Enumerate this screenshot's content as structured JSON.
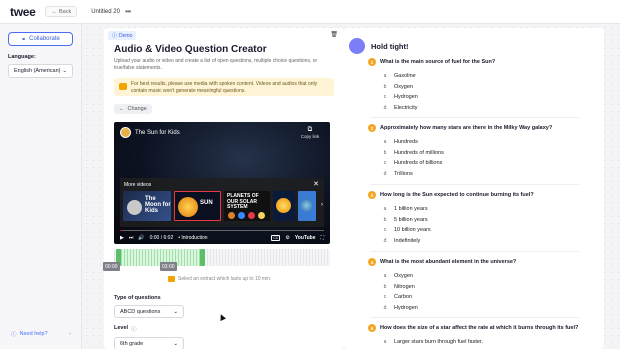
{
  "app": {
    "logo": "twee",
    "back_label": "Back",
    "doc_title": "Untitled 20",
    "menu_icon": "ellipsis-icon"
  },
  "sidebar": {
    "collaborate_label": "Collaborate",
    "language_label": "Language:",
    "language_value": "English (American)",
    "help_label": "Need help?"
  },
  "creator": {
    "badge": "Demo",
    "title": "Audio & Video Question Creator",
    "description": "Upload your audio or video and create a list of open questions, multiple choice questions, or true/false statements.",
    "tip": "For best results, please use media with spoken content. Videos and audios that only contain music won't generate meaningful questions.",
    "change_label": "Change",
    "video": {
      "title": "The Sun for Kids",
      "copy_link": "Copy link",
      "more_videos": "More videos",
      "time": "0:00 / 6:02",
      "chapter": "• Introduction",
      "thumbs": [
        {
          "text": "The Moon for Kids"
        },
        {
          "text": "SUN"
        },
        {
          "text": "PLANETS OF OUR SOLAR SYSTEM"
        }
      ]
    },
    "timeline": {
      "start": "00:00",
      "end": "03:00",
      "note": "Select an extract which lasts up to 10 min."
    },
    "type_label": "Type of questions",
    "type_value": "ABCD questions",
    "level_label": "Level",
    "level_value": "6th grade"
  },
  "results": {
    "heading": "Hold tight!",
    "questions": [
      {
        "n": "1",
        "text": "What is the main source of fuel for the Sun?",
        "options": [
          "Gasoline",
          "Oxygen",
          "Hydrogen",
          "Electricity"
        ]
      },
      {
        "n": "2",
        "text": "Approximately how many stars are there in the Milky Way galaxy?",
        "options": [
          "Hundreds",
          "Hundreds of millions",
          "Hundreds of billions",
          "Trillions"
        ]
      },
      {
        "n": "3",
        "text": "How long is the Sun expected to continue burning its fuel?",
        "options": [
          "1 billion years",
          "5 billion years",
          "10 billion years",
          "Indefinitely"
        ]
      },
      {
        "n": "4",
        "text": "What is the most abundant element in the universe?",
        "options": [
          "Oxygen",
          "Nitrogen",
          "Carbon",
          "Hydrogen"
        ]
      },
      {
        "n": "5",
        "text": "How does the size of a star affect the rate at which it burns through its fuel?",
        "options": [
          "Larger stars burn through fuel faster."
        ]
      }
    ],
    "letters": [
      "a",
      "b",
      "c",
      "d"
    ]
  },
  "colors": {
    "accent": "#4b6cf7",
    "number_badge": "#f5a623",
    "tip_bg": "#fff4d6",
    "timeline_selected": "#5bbf6a"
  }
}
